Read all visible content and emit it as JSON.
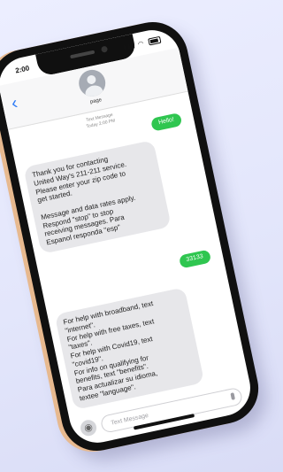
{
  "status_bar": {
    "time": "2:00",
    "signal_icon": "signal-icon",
    "wifi_icon": "wifi-icon",
    "battery_icon": "battery-icon"
  },
  "header": {
    "back_icon": "chevron-left-icon",
    "contact_name": "page"
  },
  "thread": {
    "timestamp_line1": "Text Message",
    "timestamp_line2": "Today 2:00 PM",
    "messages": [
      {
        "direction": "sent",
        "text": "Hello!"
      },
      {
        "direction": "received",
        "text": "Thank you for contacting\nUnited Way's 211-211 service.\nPlease enter your zip code to\nget started.\n\nMessage and data rates apply.\nRespond \"stop\" to stop\nreceiving messages. Para\nEspanol responda \"esp\""
      },
      {
        "direction": "sent",
        "text": "33133"
      },
      {
        "direction": "received",
        "text": "For help with broadband, text\n\"internet\".\nFor help with free taxes, text\n\"taxes\".\nFor help with Covid19, text\n\"covid19\".\nFor info on qualifying for\nbenefits, text \"benefits\".\nPara actualizar su idioma,\ntextee \"language\"."
      }
    ]
  },
  "composer": {
    "camera_icon": "camera-icon",
    "placeholder": "Text Message",
    "mic_icon": "mic-icon"
  },
  "colors": {
    "sent_bubble": "#2fc650",
    "received_bubble": "#e7e7ea",
    "accent": "#2f7cf6"
  }
}
